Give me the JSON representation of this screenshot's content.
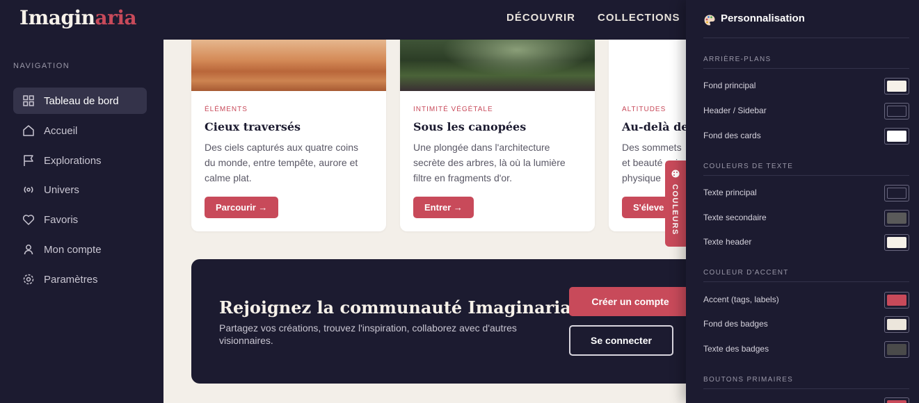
{
  "header": {
    "logo_main": "Imagin",
    "logo_accent": "aria",
    "nav": [
      "DÉCOUVRIR",
      "COLLECTIONS"
    ]
  },
  "sidebar": {
    "heading": "NAVIGATION",
    "items": [
      {
        "label": "Tableau de bord",
        "icon": "grid-icon",
        "active": true
      },
      {
        "label": "Accueil",
        "icon": "home-icon"
      },
      {
        "label": "Explorations",
        "icon": "flag-icon"
      },
      {
        "label": "Univers",
        "icon": "radio-icon"
      },
      {
        "label": "Favoris",
        "icon": "heart-icon"
      },
      {
        "label": "Mon compte",
        "icon": "user-icon"
      },
      {
        "label": "Paramètres",
        "icon": "gear-icon"
      }
    ]
  },
  "cards": [
    {
      "tag": "ÉLÉMENTS",
      "title": "Cieux traversés",
      "desc": "Des ciels capturés aux quatre coins du monde, entre tempête, aurore et calme plat.",
      "button": "Parcourir →"
    },
    {
      "tag": "INTIMITÉ VÉGÉTALE",
      "title": "Sous les canopées",
      "desc": "Une plongée dans l'architecture secrète des arbres, là où la lumière filtre en fragments d'or.",
      "button": "Entrer →"
    },
    {
      "tag": "ALTITUDES",
      "title": "Au-delà des",
      "desc": "Des sommets et beauté exi physique",
      "button": "S'éleve"
    }
  ],
  "cta": {
    "title": "Rejoignez la communauté Imaginaria",
    "subtitle": "Partagez vos créations, trouvez l'inspiration, collaborez avec d'autres visionnaires.",
    "primary": "Créer un compte",
    "secondary": "Se connecter"
  },
  "color_tab": {
    "label": "COULEURS",
    "icon": "palette-icon"
  },
  "panel": {
    "title": "Personnalisation",
    "icon": "palette-icon",
    "sections": [
      {
        "heading": "ARRIÈRE-PLANS",
        "rows": [
          {
            "label": "Fond principal",
            "color": "#f6f1e9"
          },
          {
            "label": "Header / Sidebar",
            "color": "#1c1b30"
          },
          {
            "label": "Fond des cards",
            "color": "#ffffff"
          }
        ]
      },
      {
        "heading": "COULEURS DE TEXTE",
        "rows": [
          {
            "label": "Texte principal",
            "color": "#1c1b30"
          },
          {
            "label": "Texte secondaire",
            "color": "#5a5a5a"
          },
          {
            "label": "Texte header",
            "color": "#f6f1e9"
          }
        ]
      },
      {
        "heading": "COULEUR D'ACCENT",
        "rows": [
          {
            "label": "Accent (tags, labels)",
            "color": "#c84a5a"
          },
          {
            "label": "Fond des badges",
            "color": "#ece6dc"
          },
          {
            "label": "Texte des badges",
            "color": "#4a4a4a"
          }
        ]
      },
      {
        "heading": "BOUTONS PRIMAIRES",
        "rows": []
      }
    ]
  },
  "colors": {
    "accent": "#c84a5a",
    "dark": "#1c1b30",
    "background": "#f3efe9"
  }
}
